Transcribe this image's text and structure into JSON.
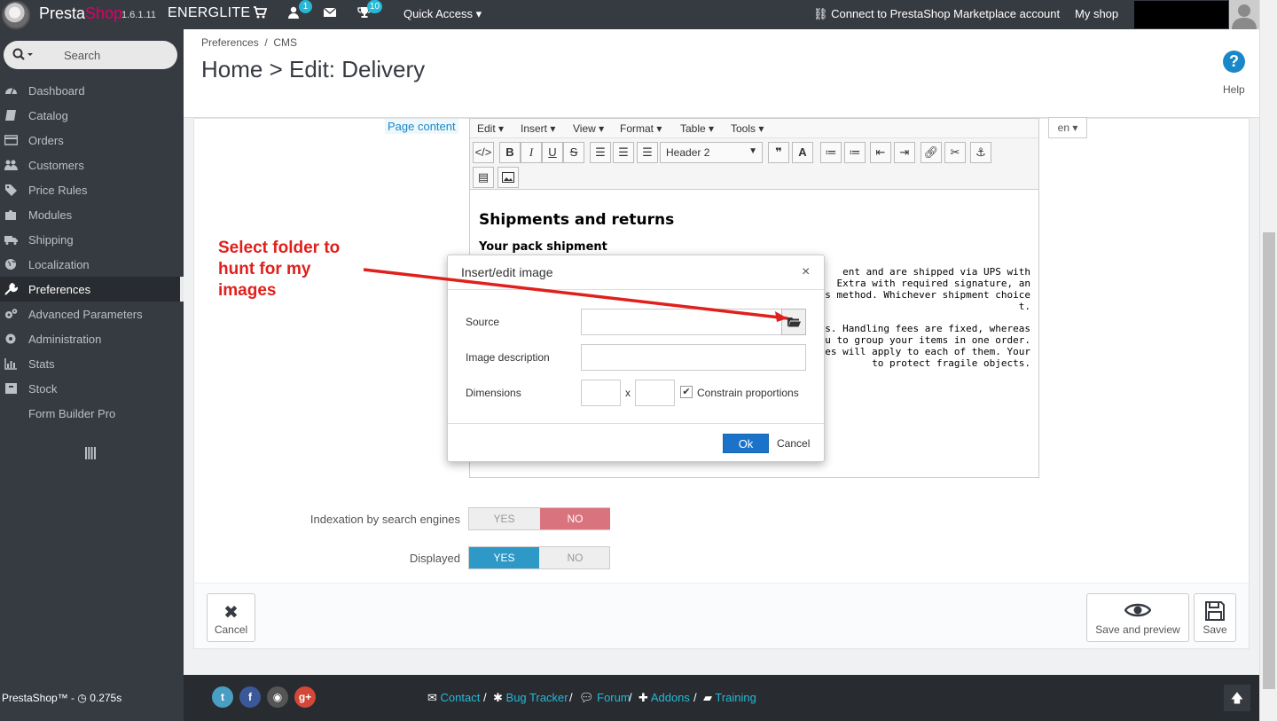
{
  "topbar": {
    "brand_a": "Presta",
    "brand_b": "Shop",
    "version": "1.6.1.11",
    "shop_name": "ENERGLITE",
    "customers_badge": "1",
    "trophy_badge": "10",
    "quick_access": "Quick Access",
    "connect": "Connect to PrestaShop Marketplace account",
    "my_shop": "My shop"
  },
  "sidebar": {
    "search_label": "Search",
    "items": [
      {
        "label": "Dashboard",
        "icon": "dashboard-icon"
      },
      {
        "label": "Catalog",
        "icon": "book-icon"
      },
      {
        "label": "Orders",
        "icon": "credit-card-icon"
      },
      {
        "label": "Customers",
        "icon": "users-icon"
      },
      {
        "label": "Price Rules",
        "icon": "tag-icon"
      },
      {
        "label": "Modules",
        "icon": "puzzle-icon"
      },
      {
        "label": "Shipping",
        "icon": "truck-icon"
      },
      {
        "label": "Localization",
        "icon": "globe-icon"
      },
      {
        "label": "Preferences",
        "icon": "wrench-icon",
        "active": true
      },
      {
        "label": "Advanced Parameters",
        "icon": "cogs-icon"
      },
      {
        "label": "Administration",
        "icon": "cog-icon"
      },
      {
        "label": "Stats",
        "icon": "bar-chart-icon"
      },
      {
        "label": "Stock",
        "icon": "archive-icon"
      },
      {
        "label": "Form Builder Pro",
        "icon": ""
      }
    ]
  },
  "header": {
    "breadcrumb_1": "Preferences",
    "breadcrumb_sep": "/",
    "breadcrumb_2": "CMS",
    "title": "Home > Edit: Delivery",
    "help_label": "Help"
  },
  "form": {
    "page_content_label": "Page content",
    "lang": "en",
    "menus": [
      "Edit",
      "Insert",
      "View",
      "Format",
      "Table",
      "Tools"
    ],
    "format_select": "Header 2",
    "doc_h2": "Shipments and returns",
    "doc_h3": "Your pack shipment",
    "doc_lines": [
      "ent and are shipped via UPS with",
      "Extra with required signature, an",
      "is method. Whichever shipment choice",
      "t.",
      "",
      "sts. Handling fees are fixed, whereas",
      "se you to group your items in one order.",
      "ees will apply to each of them. Your",
      "to protect fragile objects."
    ],
    "indexation_label": "Indexation by search engines",
    "displayed_label": "Displayed",
    "yes": "YES",
    "no": "NO",
    "cancel_btn": "Cancel",
    "save_preview_btn": "Save and preview",
    "save_btn": "Save"
  },
  "annotation": {
    "line1": "Select folder to",
    "line2": "hunt for my",
    "line3": "images",
    "color": "#e0201c"
  },
  "dialog": {
    "title": "Insert/edit image",
    "close": "×",
    "source_label": "Source",
    "source_value": "",
    "description_label": "Image description",
    "description_value": "",
    "dimensions_label": "Dimensions",
    "width_value": "",
    "height_value": "",
    "x": "x",
    "constrain_label": "Constrain proportions",
    "constrain_checked": true,
    "ok": "Ok",
    "cancel": "Cancel"
  },
  "footer": {
    "stat": "PrestaShop™ - ",
    "time": "0.275s",
    "links": [
      "Contact",
      "Bug Tracker",
      "Forum",
      "Addons",
      "Training"
    ],
    "sep": "/"
  }
}
